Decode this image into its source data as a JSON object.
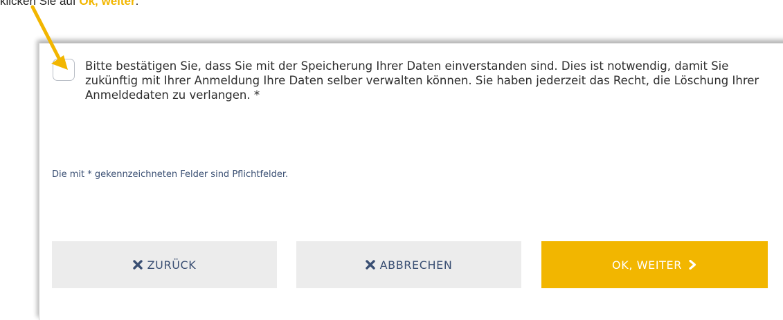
{
  "instruction": {
    "prefix": "klicken Sie auf ",
    "highlight": "Ok, weiter",
    "suffix": "."
  },
  "consent": {
    "text": "Bitte bestätigen Sie, dass Sie mit der Speicherung Ihrer Daten einverstanden sind. Dies ist notwendig, damit Sie zukünftig mit Ihrer Anmeldung Ihre Daten selber verwalten können. Sie haben jederzeit das Recht, die Löschung Ihrer Anmeldedaten zu verlangen. *",
    "checked": false
  },
  "form": {
    "required_note": "Die mit * gekennzeichneten Felder sind Pflichtfelder."
  },
  "buttons": {
    "back_label": "ZURÜCK",
    "cancel_label": "ABBRECHEN",
    "next_label": "OK, WEITER"
  },
  "icons": {
    "back": "x-icon",
    "cancel": "x-icon",
    "next": "chevron-right-icon",
    "annotation": "arrow-icon"
  },
  "colors": {
    "accent": "#F2B600",
    "button_grey": "#ECECEC",
    "button_text": "#3A4F73",
    "body_text": "#2D2D2D"
  }
}
